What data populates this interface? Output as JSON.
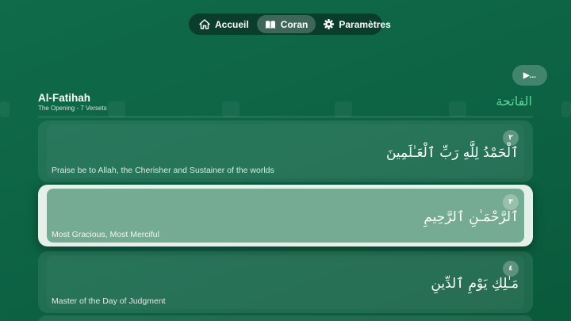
{
  "nav": {
    "items": [
      {
        "label": "Accueil",
        "icon": "home-icon",
        "active": false
      },
      {
        "label": "Coran",
        "icon": "book-icon",
        "active": true
      },
      {
        "label": "Paramètres",
        "icon": "gear-icon",
        "active": false
      }
    ]
  },
  "player": {
    "play_label": "▶..."
  },
  "surah": {
    "name": "Al-Fatihah",
    "subtitle": "The Opening - 7 Versets",
    "arabic_name": "الفاتحة"
  },
  "verses": [
    {
      "number": "٢",
      "arabic": "ٱلْحَمْدُ لِلَّهِ رَبِّ ٱلْعَـٰلَمِينَ",
      "translation": "Praise be to Allah, the Cherisher and Sustainer of the worlds",
      "active": false
    },
    {
      "number": "٣",
      "arabic": "ٱلرَّحْمَـٰنِ ٱلرَّحِيمِ",
      "translation": "Most Gracious, Most Merciful",
      "active": true
    },
    {
      "number": "٤",
      "arabic": "مَـٰلِكِ يَوْمِ ٱلدِّينِ",
      "translation": "Master of the Day of Judgment",
      "active": false
    }
  ],
  "colors": {
    "background": "#0d6445",
    "nav_background": "#0a3d2b",
    "accent_arabic_title": "#5fd49a",
    "active_card_border": "#e6f0eb",
    "active_card_fill": "#75ab92"
  }
}
